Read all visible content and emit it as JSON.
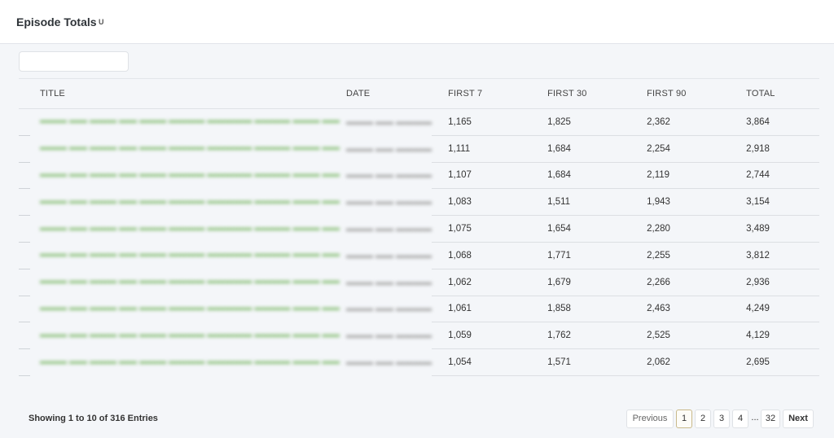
{
  "header": {
    "title": "Episode Totals",
    "sort_indicator": "U"
  },
  "table": {
    "columns": [
      "TITLE",
      "DATE",
      "FIRST 7",
      "FIRST 30",
      "FIRST 90",
      "TOTAL"
    ],
    "rows": [
      {
        "title": "",
        "date": "",
        "first7": "1,165",
        "first30": "1,825",
        "first90": "2,362",
        "total": "3,864"
      },
      {
        "title": "",
        "date": "",
        "first7": "1,111",
        "first30": "1,684",
        "first90": "2,254",
        "total": "2,918"
      },
      {
        "title": "",
        "date": "",
        "first7": "1,107",
        "first30": "1,684",
        "first90": "2,119",
        "total": "2,744"
      },
      {
        "title": "",
        "date": "",
        "first7": "1,083",
        "first30": "1,511",
        "first90": "1,943",
        "total": "3,154"
      },
      {
        "title": "",
        "date": "",
        "first7": "1,075",
        "first30": "1,654",
        "first90": "2,280",
        "total": "3,489"
      },
      {
        "title": "",
        "date": "",
        "first7": "1,068",
        "first30": "1,771",
        "first90": "2,255",
        "total": "3,812"
      },
      {
        "title": "",
        "date": "",
        "first7": "1,062",
        "first30": "1,679",
        "first90": "2,266",
        "total": "2,936"
      },
      {
        "title": "",
        "date": "",
        "first7": "1,061",
        "first30": "1,858",
        "first90": "2,463",
        "total": "4,249"
      },
      {
        "title": "",
        "date": "",
        "first7": "1,059",
        "first30": "1,762",
        "first90": "2,525",
        "total": "4,129"
      },
      {
        "title": "",
        "date": "",
        "first7": "1,054",
        "first30": "1,571",
        "first90": "2,062",
        "total": "2,695"
      }
    ]
  },
  "footer": {
    "info": "Showing 1 to 10 of 316 Entries",
    "previous": "Previous",
    "pages": [
      "1",
      "2",
      "3",
      "4"
    ],
    "ellipsis": "...",
    "last_page": "32",
    "next": "Next",
    "active_page": "1"
  },
  "colors": {
    "link_green": "#8fc27f",
    "active_page_border": "#c9b98a",
    "background": "#f4f6f9"
  }
}
